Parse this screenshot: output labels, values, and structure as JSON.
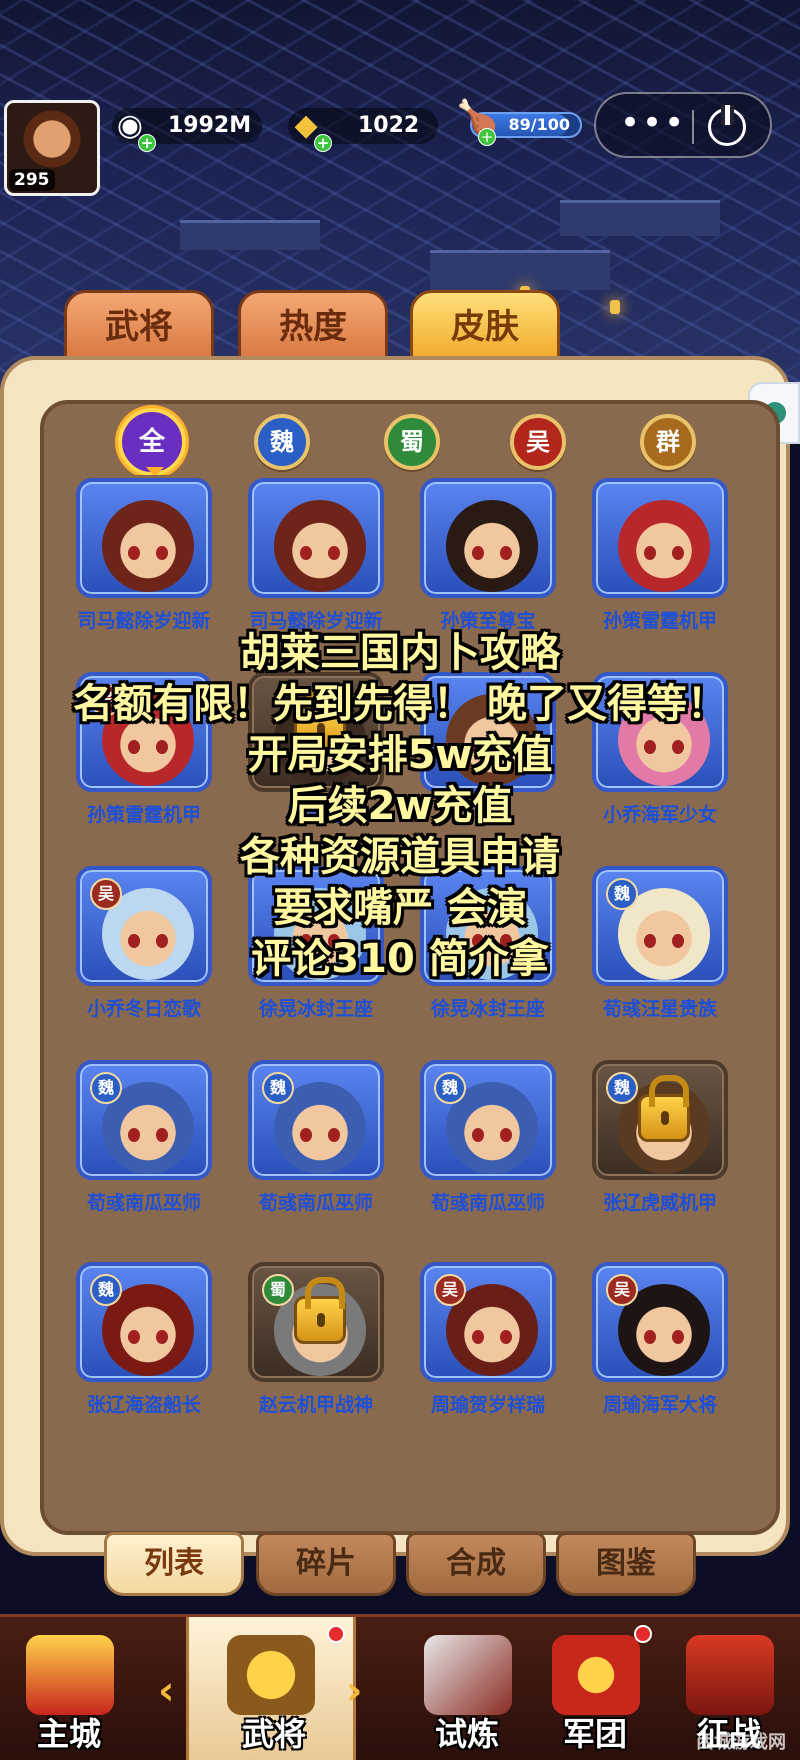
{
  "player": {
    "level": "295"
  },
  "resources": {
    "silver": "1992M",
    "gold": "1022",
    "stamina": "89/100",
    "stamina_fraction": 0.89
  },
  "capsule": {
    "more": "•••"
  },
  "top_tabs": [
    "武将",
    "热度",
    "皮肤"
  ],
  "active_top_tab": 2,
  "factions": [
    "全",
    "魏",
    "蜀",
    "吴",
    "群"
  ],
  "cards": [
    {
      "name": "司马懿除岁迎新",
      "badge": "",
      "locked": false
    },
    {
      "name": "司马懿除岁迎新",
      "badge": "",
      "locked": false
    },
    {
      "name": "孙策至尊宝",
      "badge": "",
      "locked": false
    },
    {
      "name": "孙策雷霆机甲",
      "badge": "",
      "locked": false
    },
    {
      "name": "孙策雷霆机甲",
      "badge": "吴",
      "locked": false
    },
    {
      "name": "孙策至",
      "badge": "",
      "locked": true
    },
    {
      "name": "",
      "badge": "",
      "locked": false
    },
    {
      "name": "小乔海军少女",
      "badge": "吴",
      "locked": false
    },
    {
      "name": "小乔冬日恋歌",
      "badge": "吴",
      "locked": false
    },
    {
      "name": "徐晃冰封王座",
      "badge": "",
      "locked": false
    },
    {
      "name": "徐晃冰封王座",
      "badge": "",
      "locked": false
    },
    {
      "name": "荀彧汪星贵族",
      "badge": "魏",
      "locked": false
    },
    {
      "name": "荀彧南瓜巫师",
      "badge": "魏",
      "locked": false
    },
    {
      "name": "荀彧南瓜巫师",
      "badge": "魏",
      "locked": false
    },
    {
      "name": "荀彧南瓜巫师",
      "badge": "魏",
      "locked": false
    },
    {
      "name": "张辽虎威机甲",
      "badge": "魏",
      "locked": true
    },
    {
      "name": "张辽海盗船长",
      "badge": "魏",
      "locked": false
    },
    {
      "name": "赵云机甲战神",
      "badge": "蜀",
      "locked": true
    },
    {
      "name": "周瑜贺岁祥瑞",
      "badge": "吴",
      "locked": false
    },
    {
      "name": "周瑜海军大将",
      "badge": "吴",
      "locked": false
    }
  ],
  "promo_lines": [
    "胡莱三国内卜攻略",
    "名额有限！先到先得！ 晚了又得等！",
    "开局安排5w充值",
    "后续2w充值",
    "各种资源道具申请",
    "要求嘴严 会演",
    "评论310 简介拿"
  ],
  "sub_tabs": [
    "列表",
    "碎片",
    "合成",
    "图鉴"
  ],
  "active_sub_tab": 0,
  "bottom_nav": [
    "主城",
    "武将",
    "试炼",
    "军团",
    "征战"
  ],
  "active_bottom_nav": 1,
  "watermark": "西城游戏网",
  "colors": {
    "card_blue": "#3458c8",
    "name_blue": "#1d4fd8",
    "tab_active": "#f0a424",
    "promo_text": "#fff8a0"
  }
}
